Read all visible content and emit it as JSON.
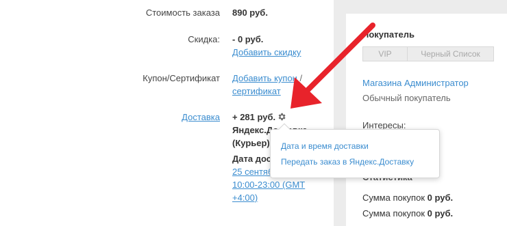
{
  "order": {
    "cost_label": "Стоимость заказа",
    "cost_value": "890 руб.",
    "discount_label": "Скидка:",
    "discount_value": "- 0 руб.",
    "add_discount": "Добавить скидку",
    "coupon_label": "Купон/Сертификат",
    "add_coupon_line1": "Добавить купон",
    "coupon_slash": " /",
    "add_coupon_line2": "сертификат",
    "delivery_label": "Доставка",
    "delivery_value": "+ 281 руб.",
    "delivery_service_line1": "Яндекс.Доставка",
    "delivery_service_line2": "(Курьер)",
    "delivery_date_label": "Дата доставки:",
    "delivery_date_link_line1": "25 сентября,",
    "delivery_date_link_line2": "10:00-23:00 (GMT",
    "delivery_date_link_line3": "+4:00)"
  },
  "popup": {
    "items": [
      "Дата и время доставки",
      "Передать заказ в Яндекс.Доставку"
    ]
  },
  "buyer": {
    "title": "Покупатель",
    "tag_vip": "VIP",
    "tag_blacklist": "Черный Список",
    "name": "Магазина Администратор",
    "type": "Обычный покупатель",
    "interests_label": "Интересы:",
    "stats_title": "Статистика",
    "purchases_label": "Сумма покупок",
    "purchases_value": "0 руб.",
    "purchases2_label": "Сумма покупок",
    "purchases2_value": "0 руб."
  },
  "colors": {
    "link": "#3a8ccf",
    "arrow": "#e8232b",
    "panel": "#ececec"
  },
  "icons": {
    "settings": "gear-icon"
  }
}
